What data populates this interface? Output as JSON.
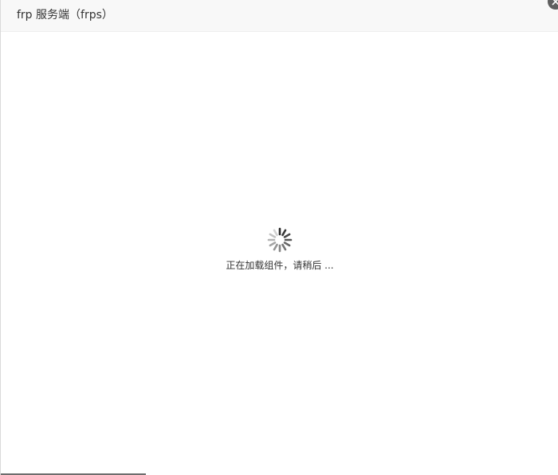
{
  "dialog": {
    "title": "frp 服务端（frps）",
    "close_icon": "close-icon"
  },
  "loading": {
    "spinner_icon": "spinner-icon",
    "message": "正在加载组件，请稍后 ..."
  }
}
